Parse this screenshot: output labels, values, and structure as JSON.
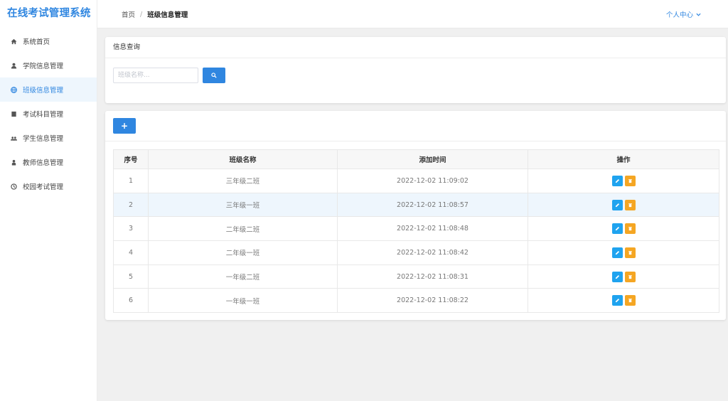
{
  "app": {
    "title": "在线考试管理系统"
  },
  "sidebar": {
    "items": [
      {
        "label": "系统首页",
        "icon": "home-icon",
        "active": false
      },
      {
        "label": "学院信息管理",
        "icon": "user-icon",
        "active": false
      },
      {
        "label": "班级信息管理",
        "icon": "globe-icon",
        "active": true
      },
      {
        "label": "考试科目管理",
        "icon": "book-icon",
        "active": false
      },
      {
        "label": "学生信息管理",
        "icon": "users-icon",
        "active": false
      },
      {
        "label": "教师信息管理",
        "icon": "teacher-icon",
        "active": false
      },
      {
        "label": "校园考试管理",
        "icon": "clock-icon",
        "active": false
      }
    ]
  },
  "header": {
    "breadcrumb_home": "首页",
    "breadcrumb_sep": "/",
    "breadcrumb_current": "班级信息管理",
    "user_center": "个人中心"
  },
  "search": {
    "title": "信息查询",
    "placeholder": "班级名称...",
    "value": ""
  },
  "table": {
    "add_label": "+",
    "columns": [
      "序号",
      "班级名称",
      "添加时间",
      "操作"
    ],
    "rows": [
      {
        "no": "1",
        "name": "三年级二班",
        "time": "2022-12-02 11:09:02"
      },
      {
        "no": "2",
        "name": "三年级一班",
        "time": "2022-12-02 11:08:57"
      },
      {
        "no": "3",
        "name": "二年级二班",
        "time": "2022-12-02 11:08:48"
      },
      {
        "no": "4",
        "name": "二年级一班",
        "time": "2022-12-02 11:08:42"
      },
      {
        "no": "5",
        "name": "一年级二班",
        "time": "2022-12-02 11:08:31"
      },
      {
        "no": "6",
        "name": "一年级一班",
        "time": "2022-12-02 11:08:22"
      }
    ],
    "highlighted_row": 2
  },
  "colors": {
    "accent": "#2f86e0",
    "edit": "#1fa3ef",
    "delete": "#f5a623",
    "active_bg": "#eef6fd"
  }
}
